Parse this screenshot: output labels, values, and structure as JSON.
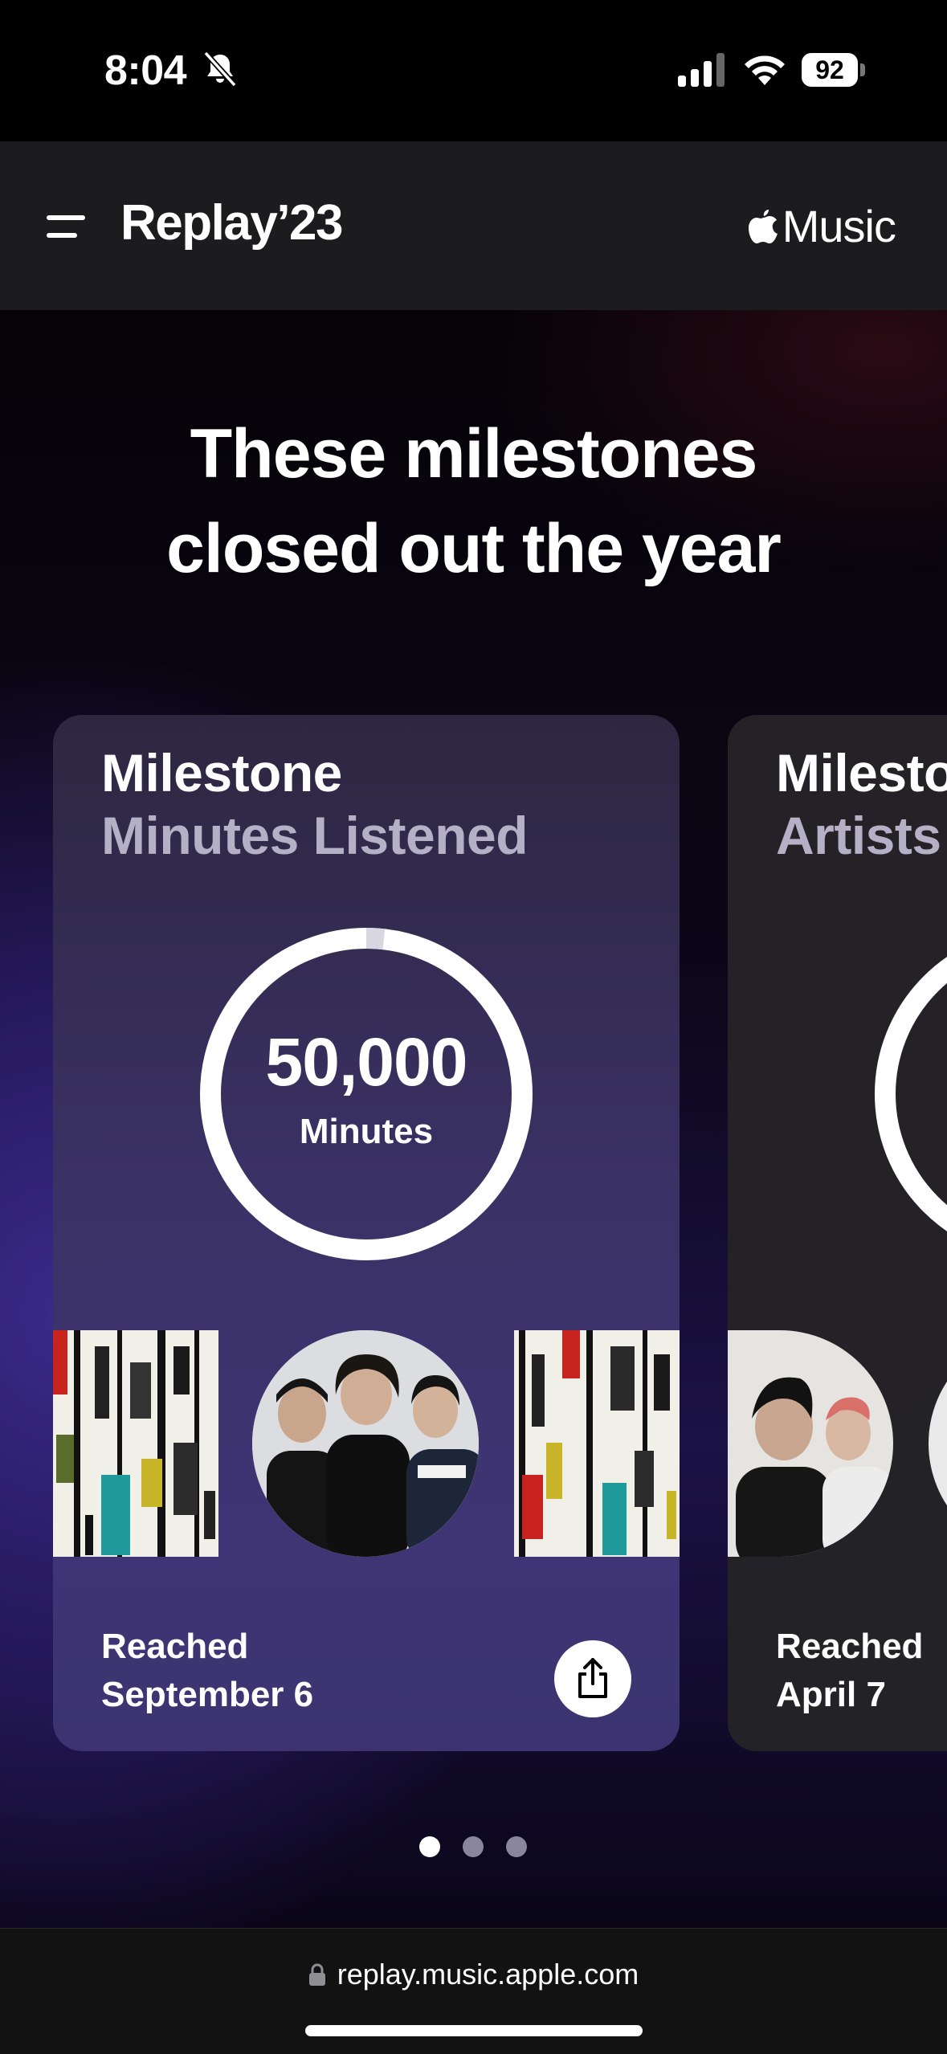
{
  "status_bar": {
    "time": "8:04",
    "battery": "92"
  },
  "nav": {
    "title": "Replay’23",
    "brand": "Music"
  },
  "main": {
    "headline_line1": "These milestones",
    "headline_line2": "closed out the year",
    "cards": [
      {
        "kicker": "Milestone",
        "subtitle": "Minutes Listened",
        "ring_value": "50,000",
        "ring_unit": "Minutes",
        "reached_line1": "Reached",
        "reached_line2": "September 6"
      },
      {
        "kicker": "Milestone",
        "subtitle": "Artists",
        "reached_line1": "Reached",
        "reached_line2": "April 7"
      }
    ],
    "page_count": 3,
    "active_page": 1
  },
  "url_bar": {
    "url": "replay.music.apple.com"
  },
  "colors": {
    "card_accent": "#3f3575",
    "background_glow": "#3a2a8a",
    "nav_bg": "#1c1c1e"
  },
  "icons": [
    "bell-slash-icon",
    "signal-icon",
    "wifi-icon",
    "menu-icon",
    "apple-logo-icon",
    "share-icon",
    "lock-icon"
  ]
}
